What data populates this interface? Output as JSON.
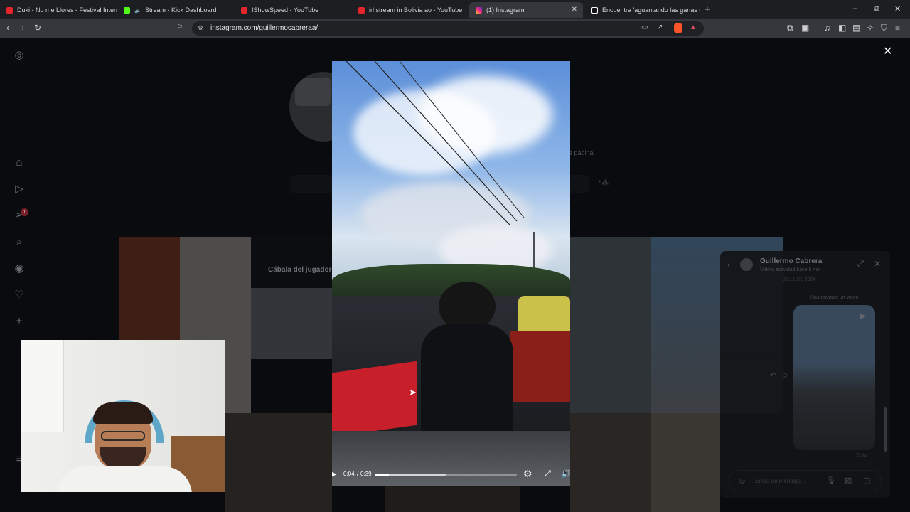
{
  "tabs": [
    {
      "title": "Duki - No me Llores - Festival Intern",
      "color": "#e4252c"
    },
    {
      "title": "Stream - Kick Dashboard",
      "color": "#53fc18"
    },
    {
      "title": "IShowSpeed - YouTube",
      "color": "#e4252c"
    },
    {
      "title": "irl stream in Bolivia ao - YouTube",
      "color": "#e4252c"
    },
    {
      "title": "(1) Instagram",
      "color": "#d6249f"
    },
    {
      "title": "Encuentra 'aguantando las ganas de",
      "color": "#ffffff"
    }
  ],
  "tab_stream_mute_icon": "speaker-icon",
  "window_controls": {
    "minimize": "–",
    "restore": "⧉",
    "close": "✕"
  },
  "new_tab": "+",
  "address": {
    "url": "instagram.com/guillermocabreraa/"
  },
  "profile": {
    "partial_link": "a página",
    "grid_caption": "Cábala del jugador"
  },
  "sidebar": {
    "notification_count": "1"
  },
  "video": {
    "current": "0:04",
    "duration": "0:39",
    "progress": 0.1,
    "buffered": 0.5
  },
  "viewer": {
    "close": "✕"
  },
  "chat": {
    "name": "Guillermo Cabrera",
    "activity": "Última actividad hace 5 min",
    "date": "09:11 23, 2024",
    "sent_note": "Has enviado un video",
    "seen": "Visto",
    "composer_placeholder": "Envía un mensaje..."
  },
  "accent": "#0095f6"
}
